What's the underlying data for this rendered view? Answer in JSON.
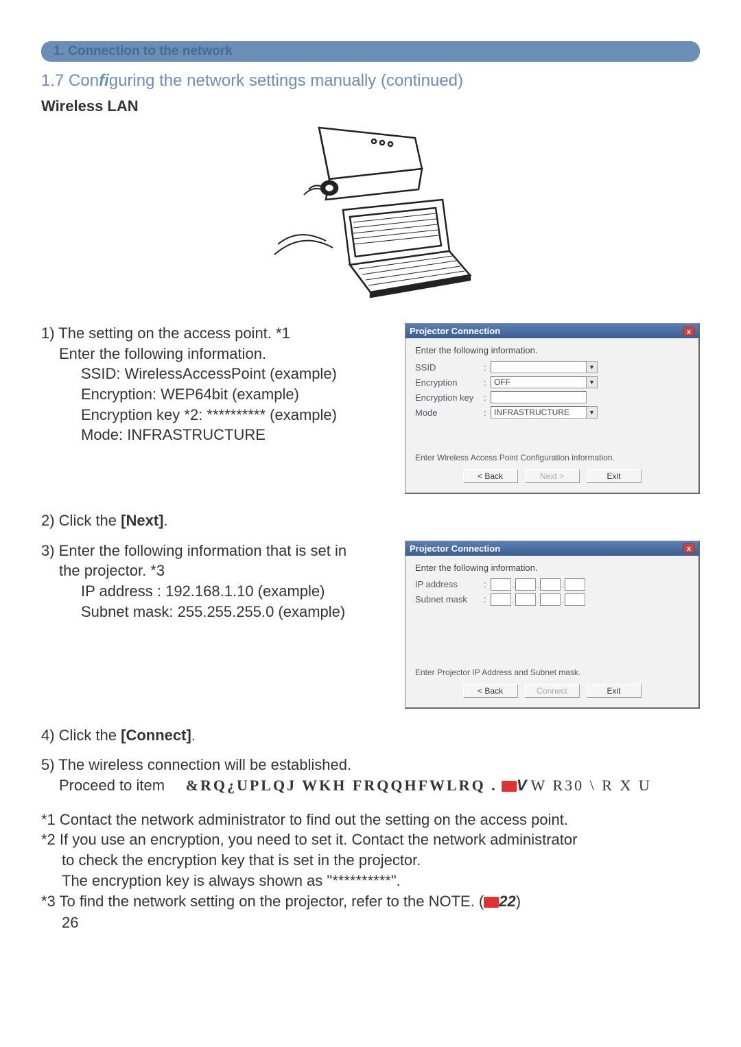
{
  "header": {
    "pill": "1. Connection to the network",
    "title_pre": "1.7 Con",
    "title_fi": "fi",
    "title_post": "guring the network settings manually (continued)",
    "subtitle": "Wireless LAN"
  },
  "step1": {
    "line1": "1) The setting on the access point. *1",
    "line2": "Enter the following information.",
    "ssid": "SSID: WirelessAccessPoint (example)",
    "enc": "Encryption: WEP64bit (example)",
    "key": "Encryption key *2: ********** (example)",
    "mode": "Mode: INFRASTRUCTURE"
  },
  "step2": "2) Click the [Next].",
  "step3": {
    "line1": "3) Enter the following information that is set in",
    "line2": "the projector. *3",
    "ip": "IP address : 192.168.1.10 (example)",
    "mask": "Subnet mask: 255.255.255.0 (example)"
  },
  "step4": "4) Click the [Connect].",
  "step5": {
    "line1": "5) The wireless connection will be established.",
    "proceed": "Proceed to item",
    "garbled1": "&RQ¿UPLQJ WKH FRQQHFWLRQ .",
    "garbled2": "W R30 \\ R X U",
    "icon_text": "V"
  },
  "notes": {
    "n1": "*1 Contact the network administrator to ﬁnd out the setting on the access point.",
    "n2a": "*2 If you use an encryption, you need to set it. Contact the network administrator",
    "n2b": "to check the encryption key that is set in the projector.",
    "n2c": "The encryption key is always shown as \"**********\".",
    "n3a": "*3 To ﬁnd the network setting on the projector, refer to the NOTE. (",
    "n3b": "22",
    "n3c": ")"
  },
  "page": "26",
  "dialog1": {
    "title": "Projector Connection",
    "close": "x",
    "heading": "Enter the following information.",
    "fields": {
      "ssid_label": "SSID",
      "ssid_value": "",
      "enc_label": "Encryption",
      "enc_value": "OFF",
      "key_label": "Encryption key",
      "key_value": "",
      "mode_label": "Mode",
      "mode_value": "INFRASTRUCTURE"
    },
    "hint": "Enter Wireless Access Point Configuration information.",
    "buttons": {
      "back": "< Back",
      "next": "Next >",
      "exit": "Exit"
    }
  },
  "dialog2": {
    "title": "Projector Connection",
    "close": "x",
    "heading": "Enter the following information.",
    "fields": {
      "ip_label": "IP address",
      "mask_label": "Subnet mask"
    },
    "hint": "Enter Projector IP Address and Subnet mask.",
    "buttons": {
      "back": "< Back",
      "connect": "Connect",
      "exit": "Exit"
    }
  }
}
